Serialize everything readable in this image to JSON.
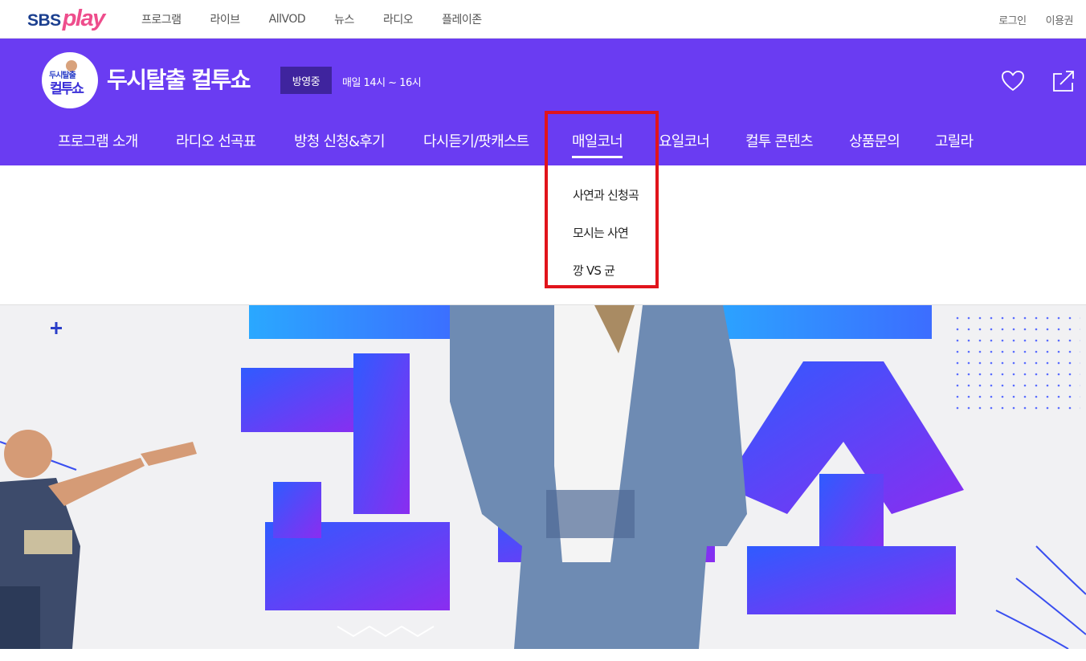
{
  "brand": {
    "sbs": "SBS",
    "play": "play"
  },
  "top_nav": [
    "프로그램",
    "라이브",
    "AllVOD",
    "뉴스",
    "라디오",
    "플레이존"
  ],
  "top_right": {
    "login": "로그인",
    "pass": "이용권"
  },
  "program": {
    "logo_text_top": "두시탈출",
    "logo_text_bottom": "컬투쇼",
    "title": "두시탈출 컬투쇼",
    "status_badge": "방영중",
    "schedule": "매일 14시 ~ 16시"
  },
  "main_nav": [
    {
      "label": "프로그램 소개",
      "active": false
    },
    {
      "label": "라디오 선곡표",
      "active": false
    },
    {
      "label": "방청 신청&후기",
      "active": false
    },
    {
      "label": "다시듣기/팟캐스트",
      "active": false
    },
    {
      "label": "매일코너",
      "active": true
    },
    {
      "label": "요일코너",
      "active": false
    },
    {
      "label": "컬투 콘텐츠",
      "active": false
    },
    {
      "label": "상품문의",
      "active": false
    },
    {
      "label": "고릴라",
      "active": false
    }
  ],
  "submenu": [
    "사연과 신청곡",
    "모시는 사연",
    "깡 VS 균"
  ],
  "colors": {
    "header_purple": "#6a3cf2",
    "badge_dark": "#3f249e",
    "highlight_red": "#e1141b",
    "logo_pink": "#ee4d8c",
    "logo_blue": "#1b3f8f"
  },
  "icons": {
    "favorite": "heart-icon",
    "share": "share-icon",
    "banner_plus": "plus-icon"
  }
}
